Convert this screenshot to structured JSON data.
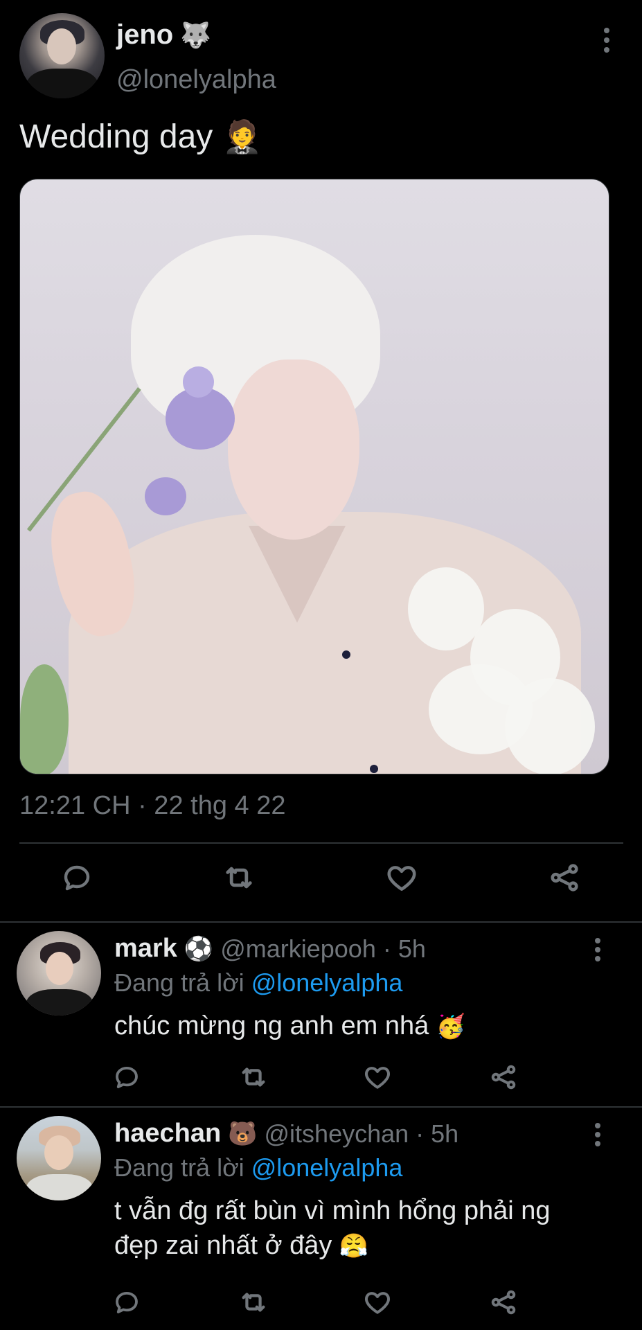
{
  "tweet": {
    "author": {
      "name": "jeno",
      "name_emoji": "🐺",
      "handle": "@lonelyalpha"
    },
    "text": "Wedding day",
    "text_emoji": "🤵",
    "timestamp": "12:21 CH · 22 thg 4 22",
    "actions": [
      "reply-icon",
      "retweet-icon",
      "like-icon",
      "share-icon"
    ]
  },
  "replies": [
    {
      "name": "mark",
      "name_emoji": "⚽",
      "handle_time": "@markiepooh · 5h",
      "replying_prefix": "Đang trả lời",
      "replying_to": "@lonelyalpha",
      "text": "chúc mừng ng anh em nhá",
      "text_emoji": "🥳"
    },
    {
      "name": "haechan",
      "name_emoji": "🐻",
      "handle_time": "@itsheychan · 5h",
      "replying_prefix": "Đang trả lời",
      "replying_to": "@lonelyalpha",
      "text_line1": "t vẫn đg rất bùn vì mình hổng phải ng",
      "text_line2": "đẹp zai nhất ở đây",
      "text_emoji": "😤"
    }
  ],
  "colors": {
    "background": "#000000",
    "text_primary": "#e7e9ea",
    "text_secondary": "#71767b",
    "link": "#1d9bf0",
    "divider": "#2f3336"
  }
}
